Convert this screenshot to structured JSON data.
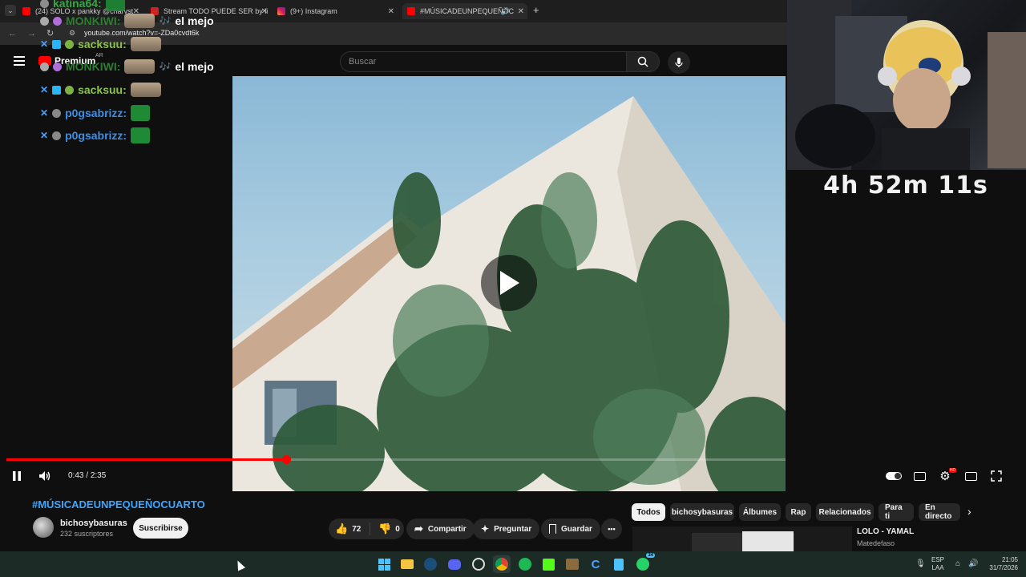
{
  "browser": {
    "tabs": [
      {
        "label": "(24) SOLO x pankky @charvst",
        "icon": "youtube-icon"
      },
      {
        "label": "Stream TODO PUEDE SER by li",
        "icon": "youtube-icon"
      },
      {
        "label": "(9+) Instagram",
        "icon": "instagram-icon"
      },
      {
        "label": "#MÚSICADEUNPEQUEÑOC",
        "icon": "youtube-icon"
      }
    ],
    "new_tab": "+",
    "url": "youtube.com/watch?v=-ZDa0cvdt6k"
  },
  "youtube": {
    "logo_label": "Premium",
    "region": "AR",
    "search_placeholder": "Buscar"
  },
  "chat": [
    {
      "user": "katina64:",
      "message": ""
    },
    {
      "user": "MONKIWI:",
      "message": "el mejo"
    },
    {
      "user": "sacksuu:",
      "message": ""
    },
    {
      "user": "MONKIWI:",
      "message": "el mejo"
    },
    {
      "user": "sacksuu:",
      "message": ""
    },
    {
      "user": "p0gsabrizz:",
      "message": ""
    },
    {
      "user": "p0gsabrizz:",
      "message": ""
    }
  ],
  "webcam": {
    "timer": "4h 52m 11s"
  },
  "player": {
    "current_time": "0:43",
    "duration": "2:35",
    "progress_fraction": 0.277,
    "hd_badge": "HD"
  },
  "video_info": {
    "title": "#MÚSICADEUNPEQUEÑOCUARTO",
    "channel": "bichosybasuras",
    "subscribers": "232 suscriptores",
    "subscribe_label": "Suscribirse",
    "likes": "72",
    "dislikes": "0",
    "share_label": "Compartir",
    "ask_label": "Preguntar",
    "save_label": "Guardar",
    "more_label": "•••"
  },
  "chips": [
    "Todos",
    "bichosybasuras",
    "Álbumes",
    "Rap",
    "Relacionados",
    "Para ti",
    "En directo"
  ],
  "recommendation": {
    "title": "LOLO - YAMAL",
    "channel": "Matedefaso"
  },
  "taskbar": {
    "lang_line1": "ESP",
    "lang_line2": "LAA",
    "time": "21:05",
    "date": "31/7/2026",
    "whatsapp_badge": "34"
  },
  "colors": {
    "accent_red": "#ff0000",
    "link_blue": "#3ea6ff",
    "chat_name_blue": "#3d8fe6"
  }
}
